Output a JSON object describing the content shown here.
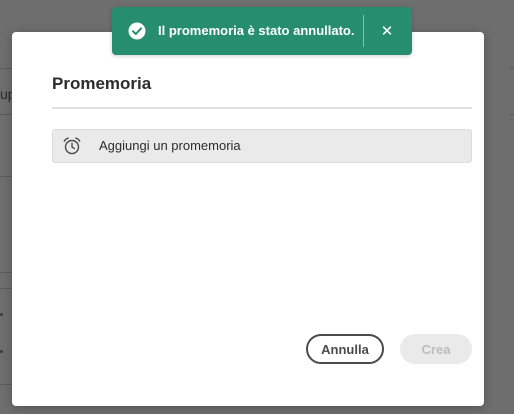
{
  "toast": {
    "message": "Il promemoria è stato annullato.",
    "icon": "checkmark-circle-icon",
    "close_icon": "close-icon",
    "close_glyph": "✕",
    "color": "#268e6c"
  },
  "dialog": {
    "title": "Promemoria",
    "reminder": {
      "label": "Aggiungi un promemoria",
      "icon": "alarm-clock-icon"
    },
    "buttons": {
      "cancel_label": "Annulla",
      "create_label": "Crea"
    }
  },
  "background": {
    "partial_text": "up"
  }
}
